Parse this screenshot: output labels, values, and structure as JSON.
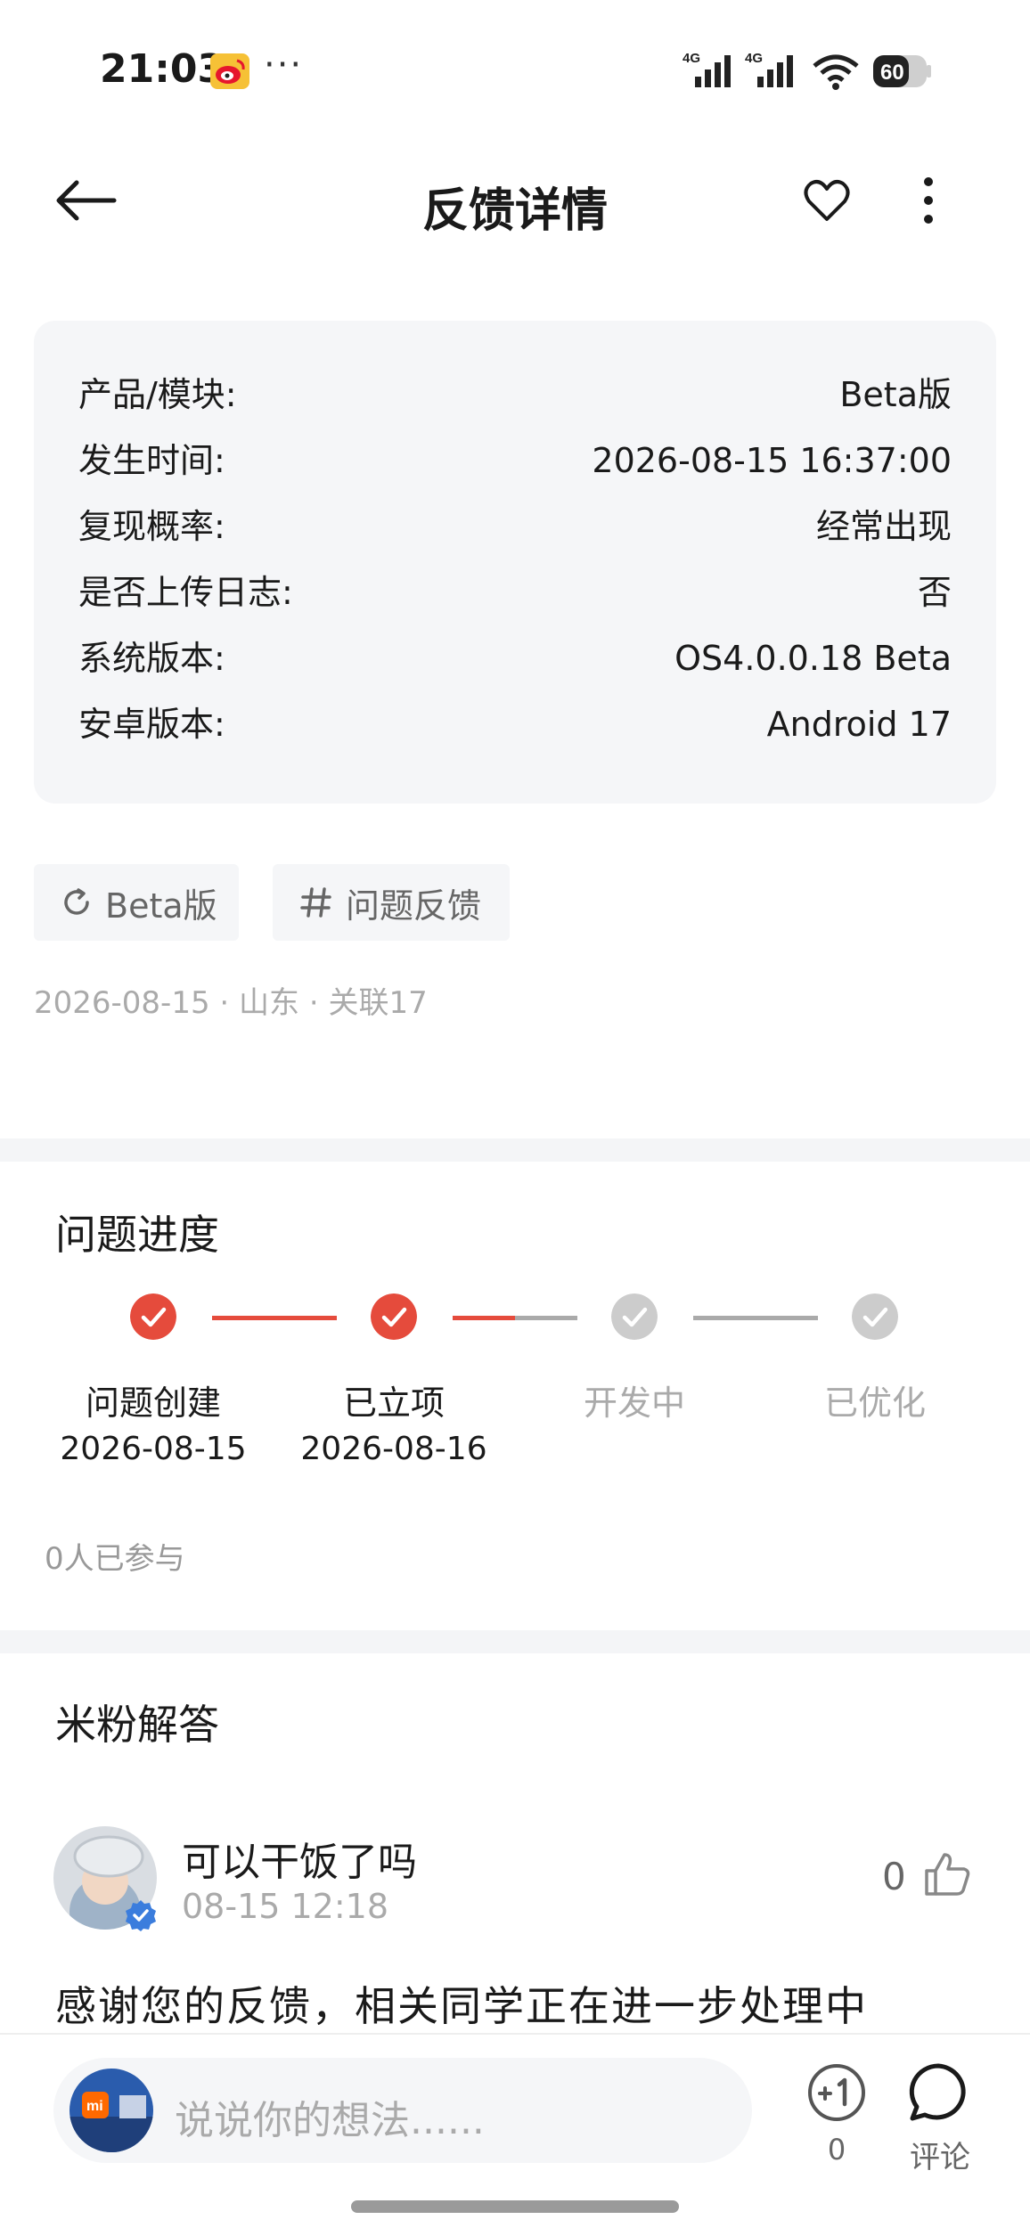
{
  "status_bar": {
    "time": "21:03",
    "dots": "···",
    "signal_1": "4G",
    "signal_2": "4G",
    "battery": "60"
  },
  "header": {
    "title": "反馈详情"
  },
  "info": {
    "rows": [
      {
        "label": "产品/模块:",
        "value": "Beta版"
      },
      {
        "label": "发生时间:",
        "value": "2026-08-15 16:37:00"
      },
      {
        "label": "复现概率:",
        "value": "经常出现"
      },
      {
        "label": "是否上传日志:",
        "value": "否"
      },
      {
        "label": "系统版本:",
        "value": "OS4.0.0.18 Beta"
      },
      {
        "label": "安卓版本:",
        "value": "Android 17"
      }
    ]
  },
  "tags": [
    {
      "label": "Beta版",
      "icon": "refresh-icon"
    },
    {
      "label": "问题反馈",
      "icon": "hash-icon"
    }
  ],
  "meta": {
    "date": "2026-08-15",
    "location": "山东",
    "related": "关联17"
  },
  "progress": {
    "title": "问题进度",
    "steps": [
      {
        "label": "问题创建",
        "date": "2026-08-15",
        "done": true
      },
      {
        "label": "已立项",
        "date": "2026-08-16",
        "done": true
      },
      {
        "label": "开发中",
        "date": "",
        "done": false
      },
      {
        "label": "已优化",
        "date": "",
        "done": false
      }
    ],
    "participants": "0人已参与",
    "colors": {
      "done": "#e54b3c",
      "pending": "#cccccc",
      "pending_text": "#aaaaaa"
    }
  },
  "answers": {
    "title": "米粉解答",
    "items": [
      {
        "user": "可以干饭了吗",
        "time": "08-15 12:18",
        "likes": "0",
        "text": "感谢您的反馈，相关同学正在进一步处理中"
      }
    ]
  },
  "bottom": {
    "placeholder": "说说你的想法......",
    "plusone_count": "0",
    "comment_label": "评论"
  }
}
